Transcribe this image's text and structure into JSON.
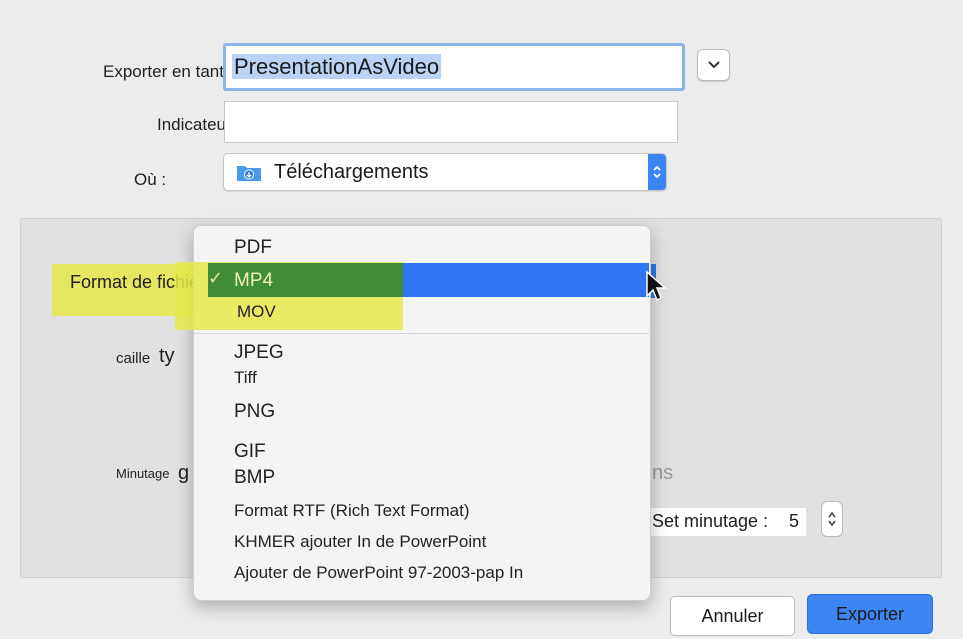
{
  "dialog": {
    "export_label": "Exporter en tant que",
    "filename": "PresentationAsVideo",
    "tags_label": "Indicateurs :",
    "tags_value": "",
    "where_label": "Où :",
    "where_value": "Téléchargements",
    "file_format_label": "Format de fichier",
    "size_label": "caille",
    "type_fragment": "ty",
    "timing_label": "Minutage",
    "timing_fragment": "g",
    "seconds_fragment": "ns",
    "set_timing_label": "Set minutage :",
    "set_timing_value": "5"
  },
  "format_menu": {
    "items": [
      {
        "label": "PDF",
        "checked": false
      },
      {
        "label": "MP4",
        "checked": true
      },
      {
        "label": "MOV",
        "checked": false
      },
      {
        "label": "JPEG",
        "checked": false
      },
      {
        "label": "Tiff",
        "checked": false
      },
      {
        "label": "PNG",
        "checked": false
      },
      {
        "label": "GIF",
        "checked": false
      },
      {
        "label": "BMP",
        "checked": false
      },
      {
        "label": "Format RTF (Rich Text Format)",
        "checked": false
      },
      {
        "label": "KHMER ajouter In de PowerPoint",
        "checked": false
      },
      {
        "label": "Ajouter de PowerPoint 97-2003-pap In",
        "checked": false
      }
    ],
    "checkmark": "✓"
  },
  "buttons": {
    "cancel": "Annuler",
    "export": "Exporter"
  },
  "colors": {
    "accent": "#2f76f0",
    "highlight_yellow": "#e6e84a",
    "highlight_green": "#3f8d36"
  }
}
